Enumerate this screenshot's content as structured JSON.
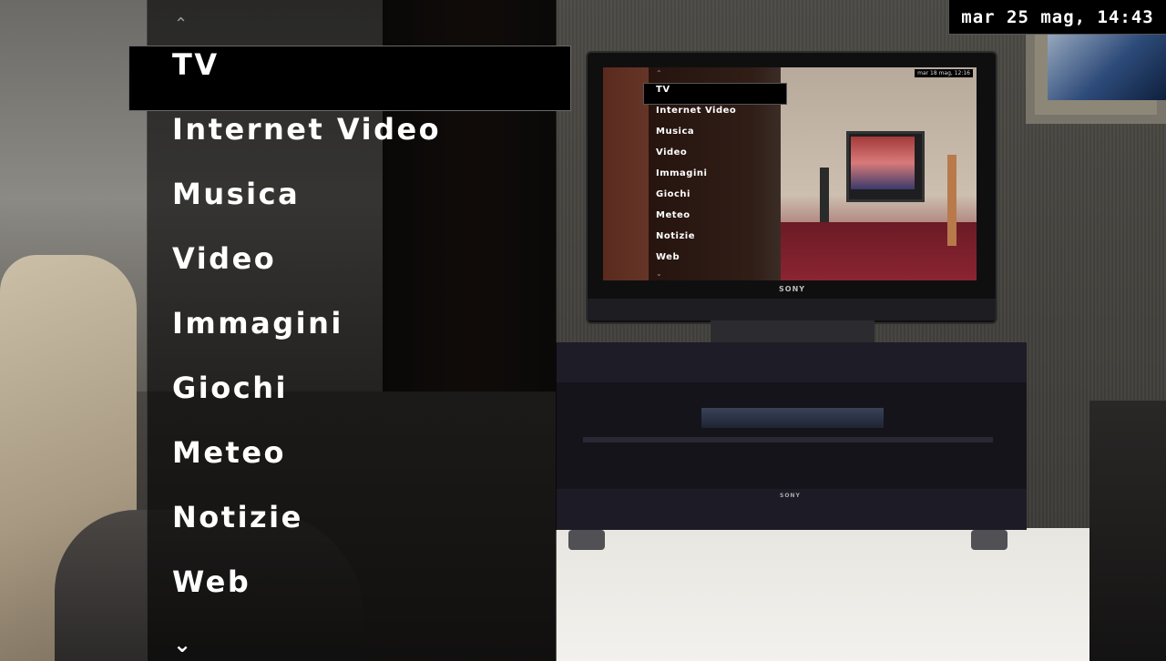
{
  "clock": {
    "text": "mar 25 mag, 14:43"
  },
  "menu": {
    "up_icon": "chevron-up-icon",
    "down_icon": "chevron-down-icon",
    "selected_index": 0,
    "items": [
      {
        "label": "TV"
      },
      {
        "label": "Internet Video"
      },
      {
        "label": "Musica"
      },
      {
        "label": "Video"
      },
      {
        "label": "Immagini"
      },
      {
        "label": "Giochi"
      },
      {
        "label": "Meteo"
      },
      {
        "label": "Notizie"
      },
      {
        "label": "Web"
      }
    ]
  },
  "background": {
    "tv_brand": "SONY",
    "cabinet_brand": "SONY",
    "inner_screen": {
      "date": "mar 18 mag, 12:16",
      "items": [
        {
          "label": "TV"
        },
        {
          "label": "Internet Video"
        },
        {
          "label": "Musica"
        },
        {
          "label": "Video"
        },
        {
          "label": "Immagini"
        },
        {
          "label": "Giochi"
        },
        {
          "label": "Meteo"
        },
        {
          "label": "Notizie"
        },
        {
          "label": "Web"
        }
      ]
    }
  },
  "colors": {
    "highlight_border": "#6a6a6a",
    "text": "#ffffff",
    "panel_overlay": "rgba(0,0,0,0.62)"
  }
}
